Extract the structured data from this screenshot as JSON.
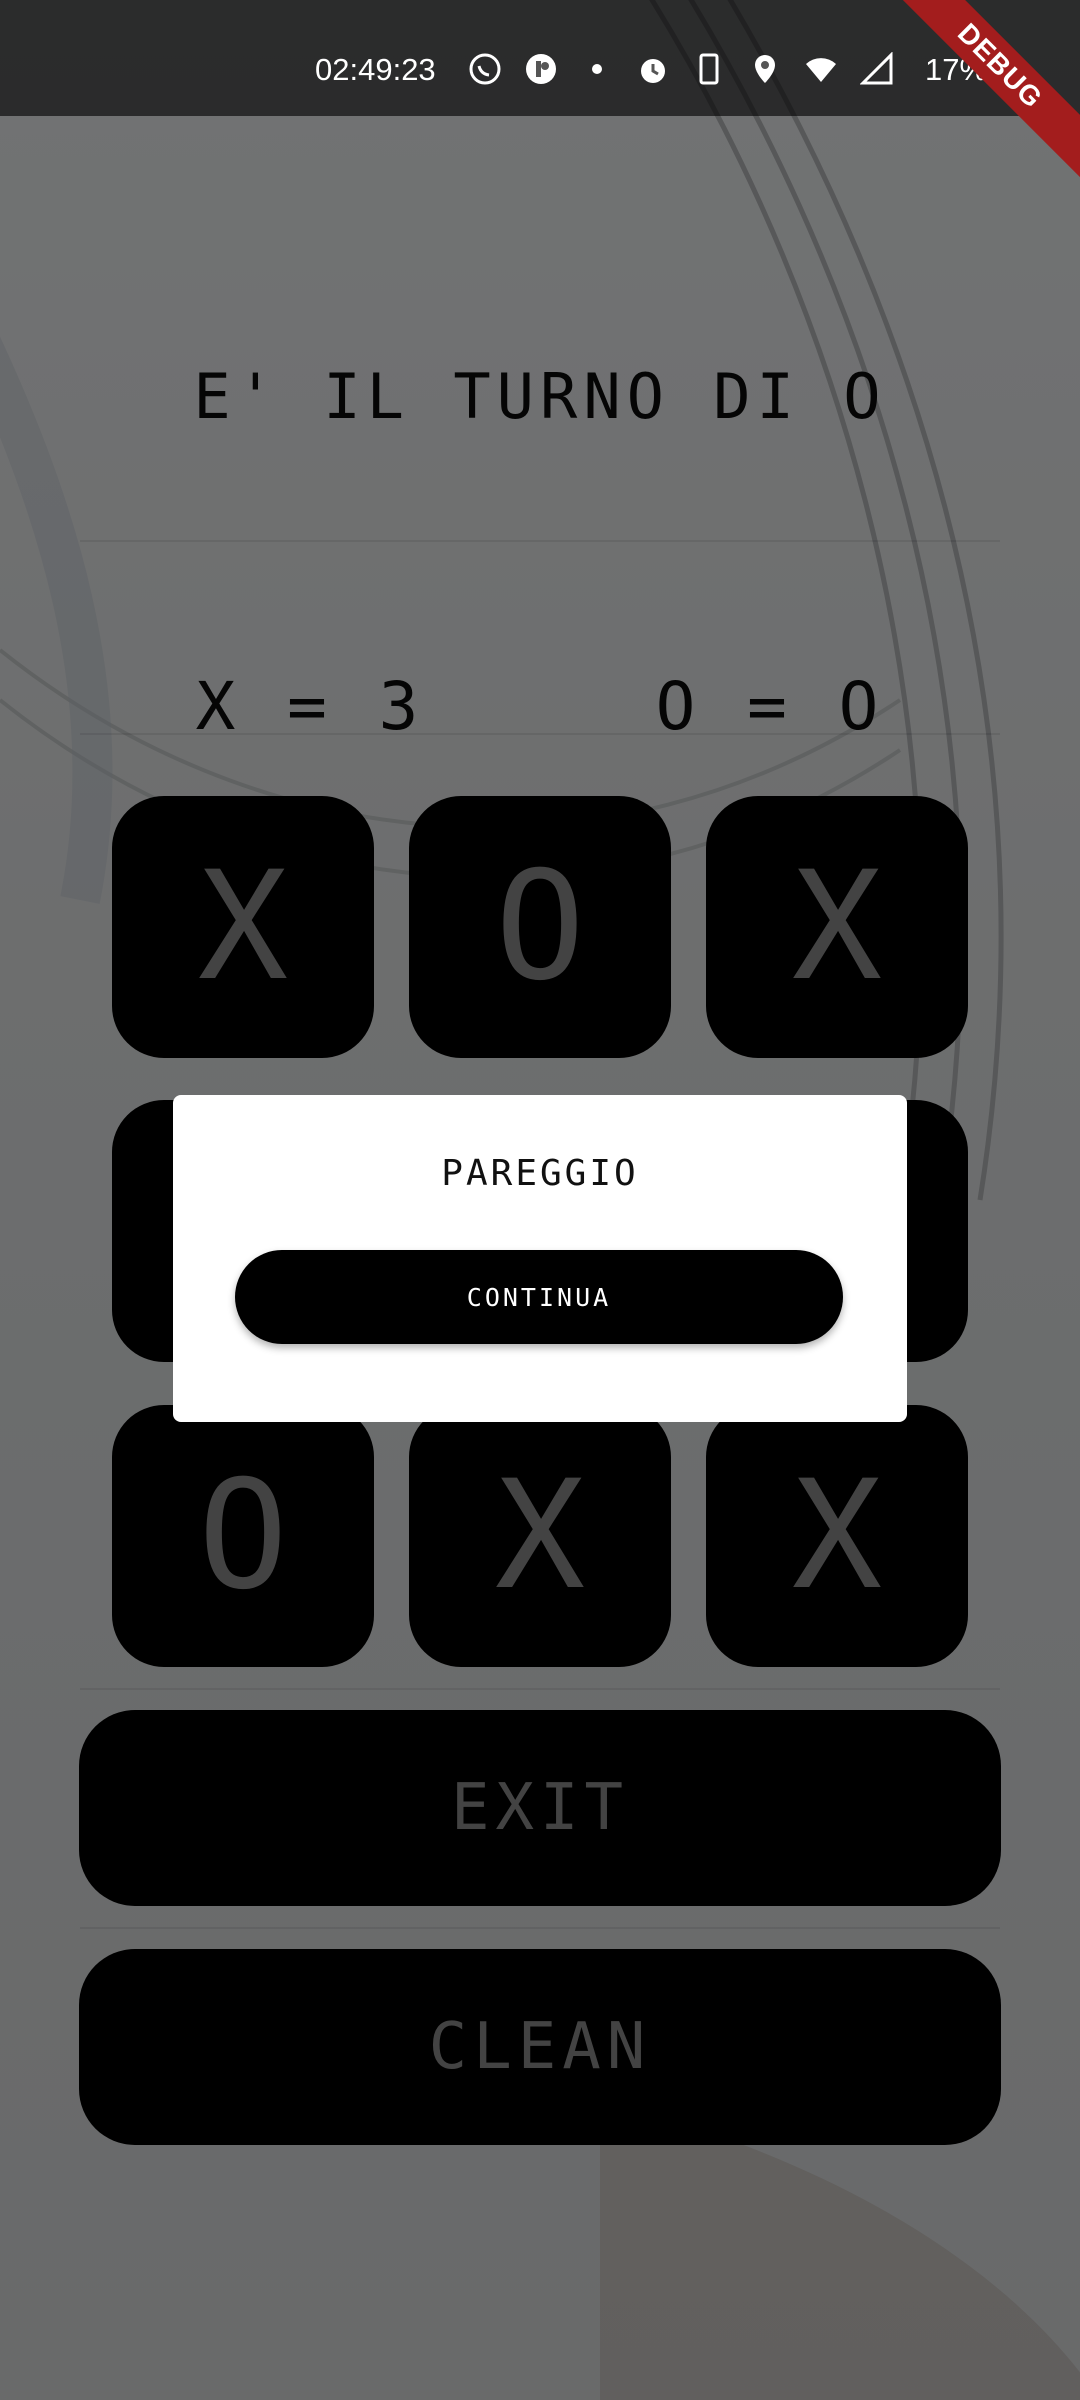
{
  "status_bar": {
    "time": "02:49:23",
    "battery": "17%",
    "icons": [
      "whatsapp-icon",
      "app-icon",
      "dot-icon",
      "alarm-icon",
      "phone-icon",
      "location-icon",
      "wifi-icon",
      "signal-icon"
    ],
    "debug_label": "DEBUG"
  },
  "game": {
    "turn_text": "E' IL TURNO DI O",
    "score_x": "X = 3",
    "score_o": "O = O",
    "board": [
      [
        "X",
        "O",
        "X"
      ],
      [
        "",
        "",
        ""
      ],
      [
        "O",
        "X",
        "X"
      ]
    ]
  },
  "buttons": {
    "exit": "EXIT",
    "clean": "CLEAN"
  },
  "dialog": {
    "title": "PAREGGIO",
    "continue_label": "CONTINUA"
  },
  "colors": {
    "cell_background": "#000000",
    "symbol_color": "#7a7a7a",
    "debug_banner": "#a31d1d"
  }
}
